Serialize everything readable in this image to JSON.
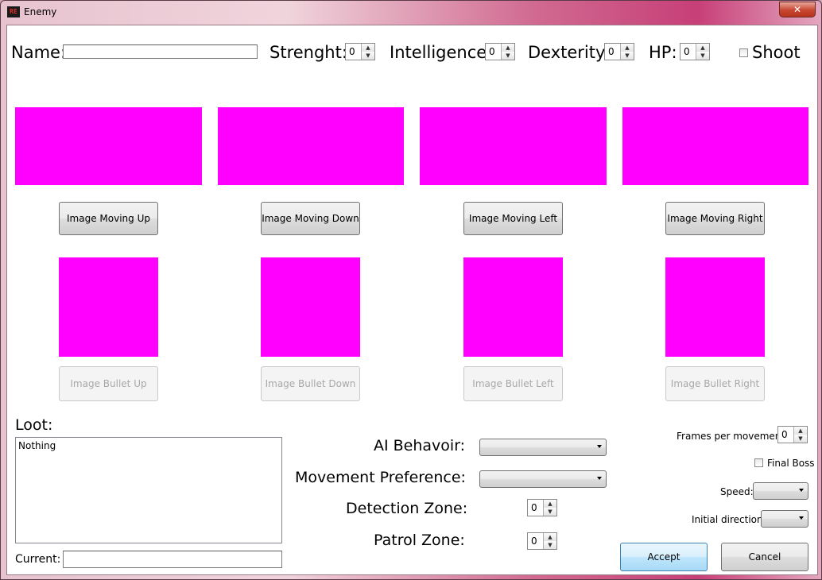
{
  "window": {
    "title": "Enemy",
    "close_symbol": "✕",
    "icon_text": "RE"
  },
  "stats": {
    "name_label": "Name:",
    "name_value": "",
    "strength_label": "Strenght:",
    "strength_value": "0",
    "intelligence_label": "Intelligence:",
    "intelligence_value": "0",
    "dexterity_label": "Dexterity:",
    "dexterity_value": "0",
    "hp_label": "HP:",
    "hp_value": "0",
    "shoot_label": "Shoot"
  },
  "images": {
    "moving_up": "Image Moving Up",
    "moving_down": "Image Moving Down",
    "moving_left": "Image Moving Left",
    "moving_right": "Image Moving Right",
    "bullet_up": "Image Bullet Up",
    "bullet_down": "Image Bullet Down",
    "bullet_left": "Image Bullet Left",
    "bullet_right": "Image Bullet Right"
  },
  "loot": {
    "label": "Loot:",
    "items": [
      "Nothing"
    ],
    "current_label": "Current:",
    "current_value": ""
  },
  "ai": {
    "behavior_label": "AI Behavoir:",
    "behavior_value": "",
    "movement_label": "Movement Preference:",
    "movement_value": "",
    "detection_label": "Detection Zone:",
    "detection_value": "0",
    "patrol_label": "Patrol Zone:",
    "patrol_value": "0"
  },
  "settings": {
    "frames_label": "Frames per movement:",
    "frames_value": "0",
    "final_boss_label": "Final Boss",
    "speed_label": "Speed:",
    "speed_value": "",
    "direction_label": "Initial direction:",
    "direction_value": ""
  },
  "actions": {
    "accept": "Accept",
    "cancel": "Cancel"
  },
  "colors": {
    "placeholder_image": "#ff00ff"
  }
}
